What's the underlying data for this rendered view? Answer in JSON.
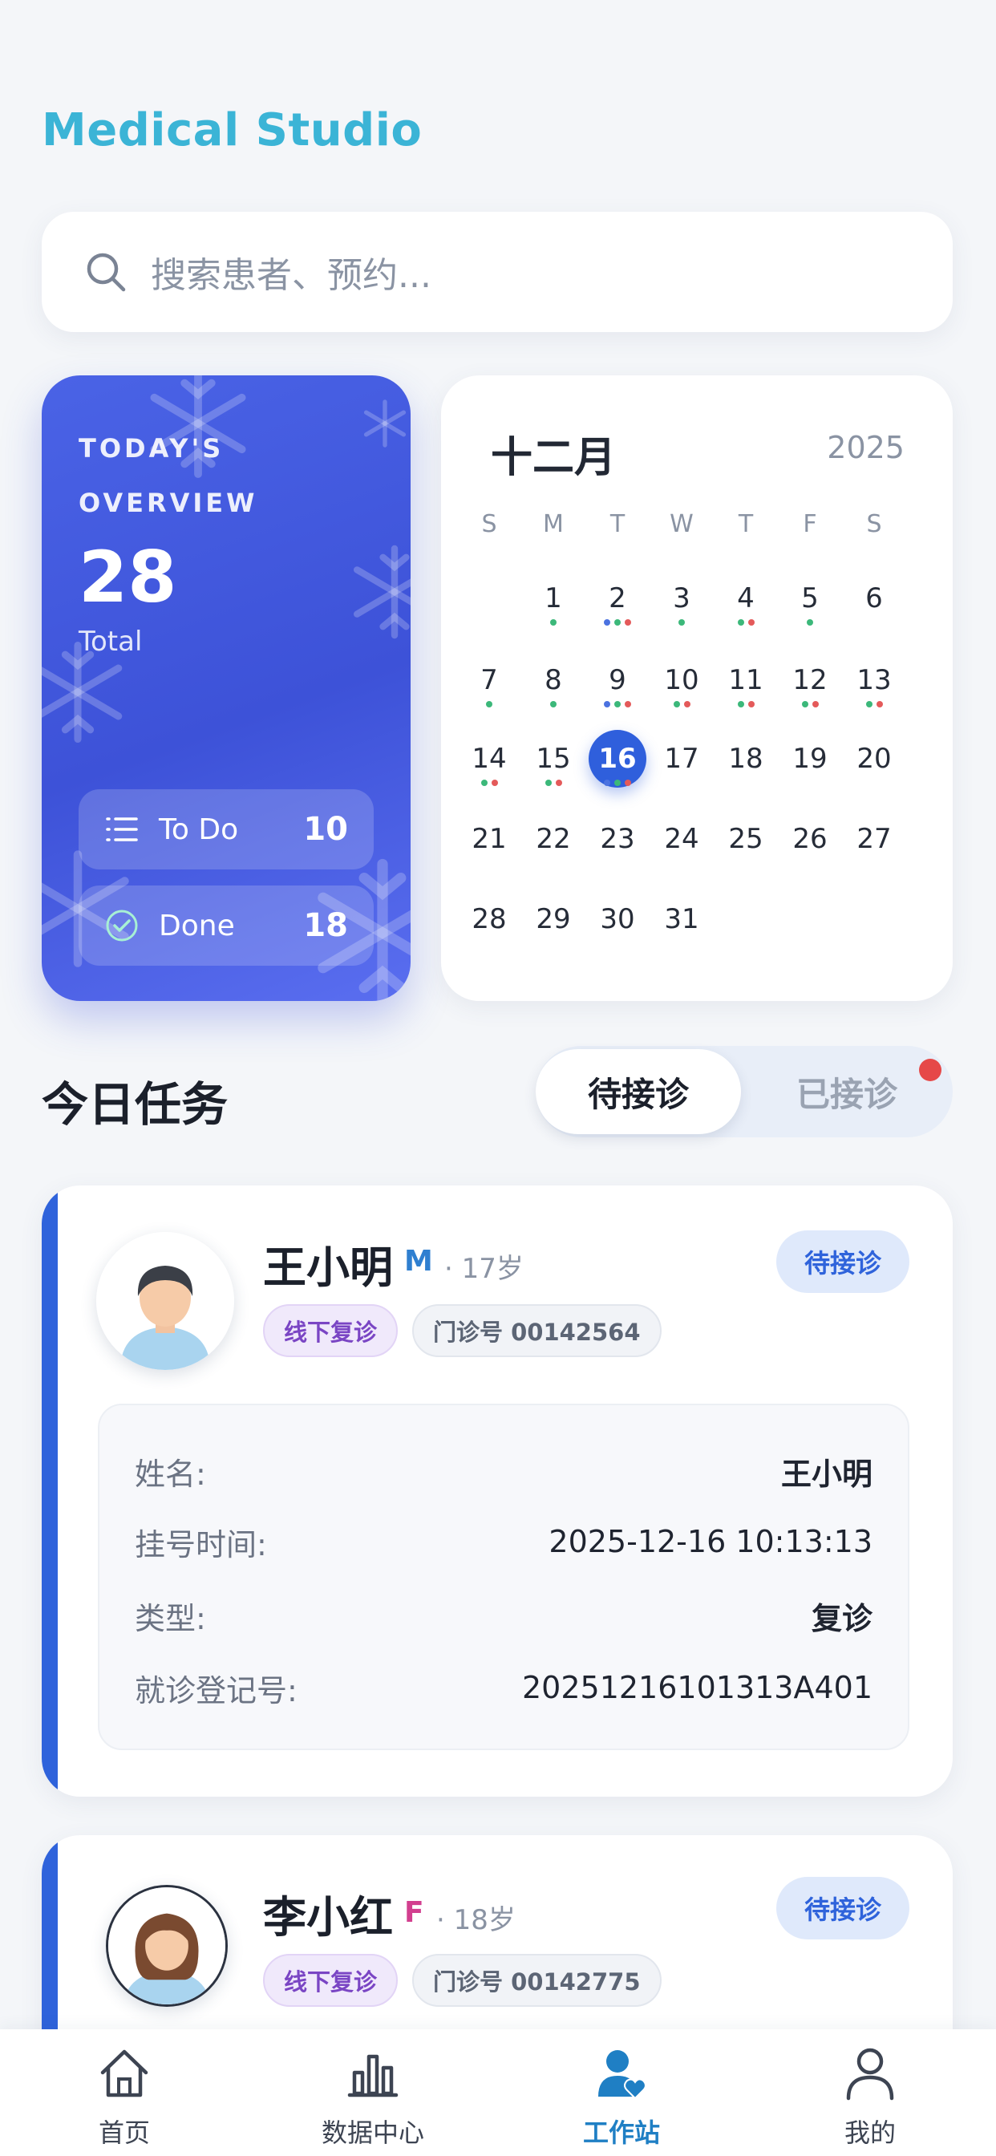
{
  "app": {
    "title": "Medical Studio"
  },
  "search": {
    "placeholder": "搜索患者、预约..."
  },
  "overview": {
    "label_line1": "TODAY'S",
    "label_line2": "OVERVIEW",
    "count": "28",
    "total_label": "Total",
    "todo_label": "To Do",
    "todo_value": "10",
    "done_label": "Done",
    "done_value": "18"
  },
  "calendar": {
    "month": "十二月",
    "year": "2025",
    "weekdays": [
      "S",
      "M",
      "T",
      "W",
      "T",
      "F",
      "S"
    ],
    "selected_day": 16,
    "weeks": [
      [
        "",
        "1",
        "2",
        "3",
        "4",
        "5",
        "6"
      ],
      [
        "7",
        "8",
        "9",
        "10",
        "11",
        "12",
        "13"
      ],
      [
        "14",
        "15",
        "16",
        "17",
        "18",
        "19",
        "20"
      ],
      [
        "21",
        "22",
        "23",
        "24",
        "25",
        "26",
        "27"
      ],
      [
        "28",
        "29",
        "30",
        "31",
        "",
        "",
        ""
      ]
    ],
    "dot_colors": {
      "g": "#3cb87a",
      "r": "#e45a5a",
      "b": "#4b72e0"
    }
  },
  "tasks": {
    "title": "今日任务",
    "tab_pending": "待接诊",
    "tab_done": "已接诊"
  },
  "patients": [
    {
      "name": "王小明",
      "sex": "M",
      "age": "· 17岁",
      "visit_type_chip": "线下复诊",
      "outpatient_chip": "门诊号 00142564",
      "status": "待接诊",
      "details": {
        "name_label": "姓名:",
        "name_value": "王小明",
        "time_label": "挂号时间:",
        "time_value": "2025-12-16 10:13:13",
        "type_label": "类型:",
        "type_value": "复诊",
        "reg_label": "就诊登记号:",
        "reg_value": "20251216101313A401"
      }
    },
    {
      "name": "李小红",
      "sex": "F",
      "age": "· 18岁",
      "visit_type_chip": "线下复诊",
      "outpatient_chip": "门诊号 00142775",
      "status": "待接诊"
    }
  ],
  "nav": {
    "home": "首页",
    "data_center": "数据中心",
    "workstation": "工作站",
    "mine": "我的"
  },
  "colors": {
    "brand": "#3bb4d6",
    "primary": "#2f63db",
    "overview_bg": "#4a63e6",
    "female": "#d23f8f",
    "male": "#2f7fd0"
  }
}
